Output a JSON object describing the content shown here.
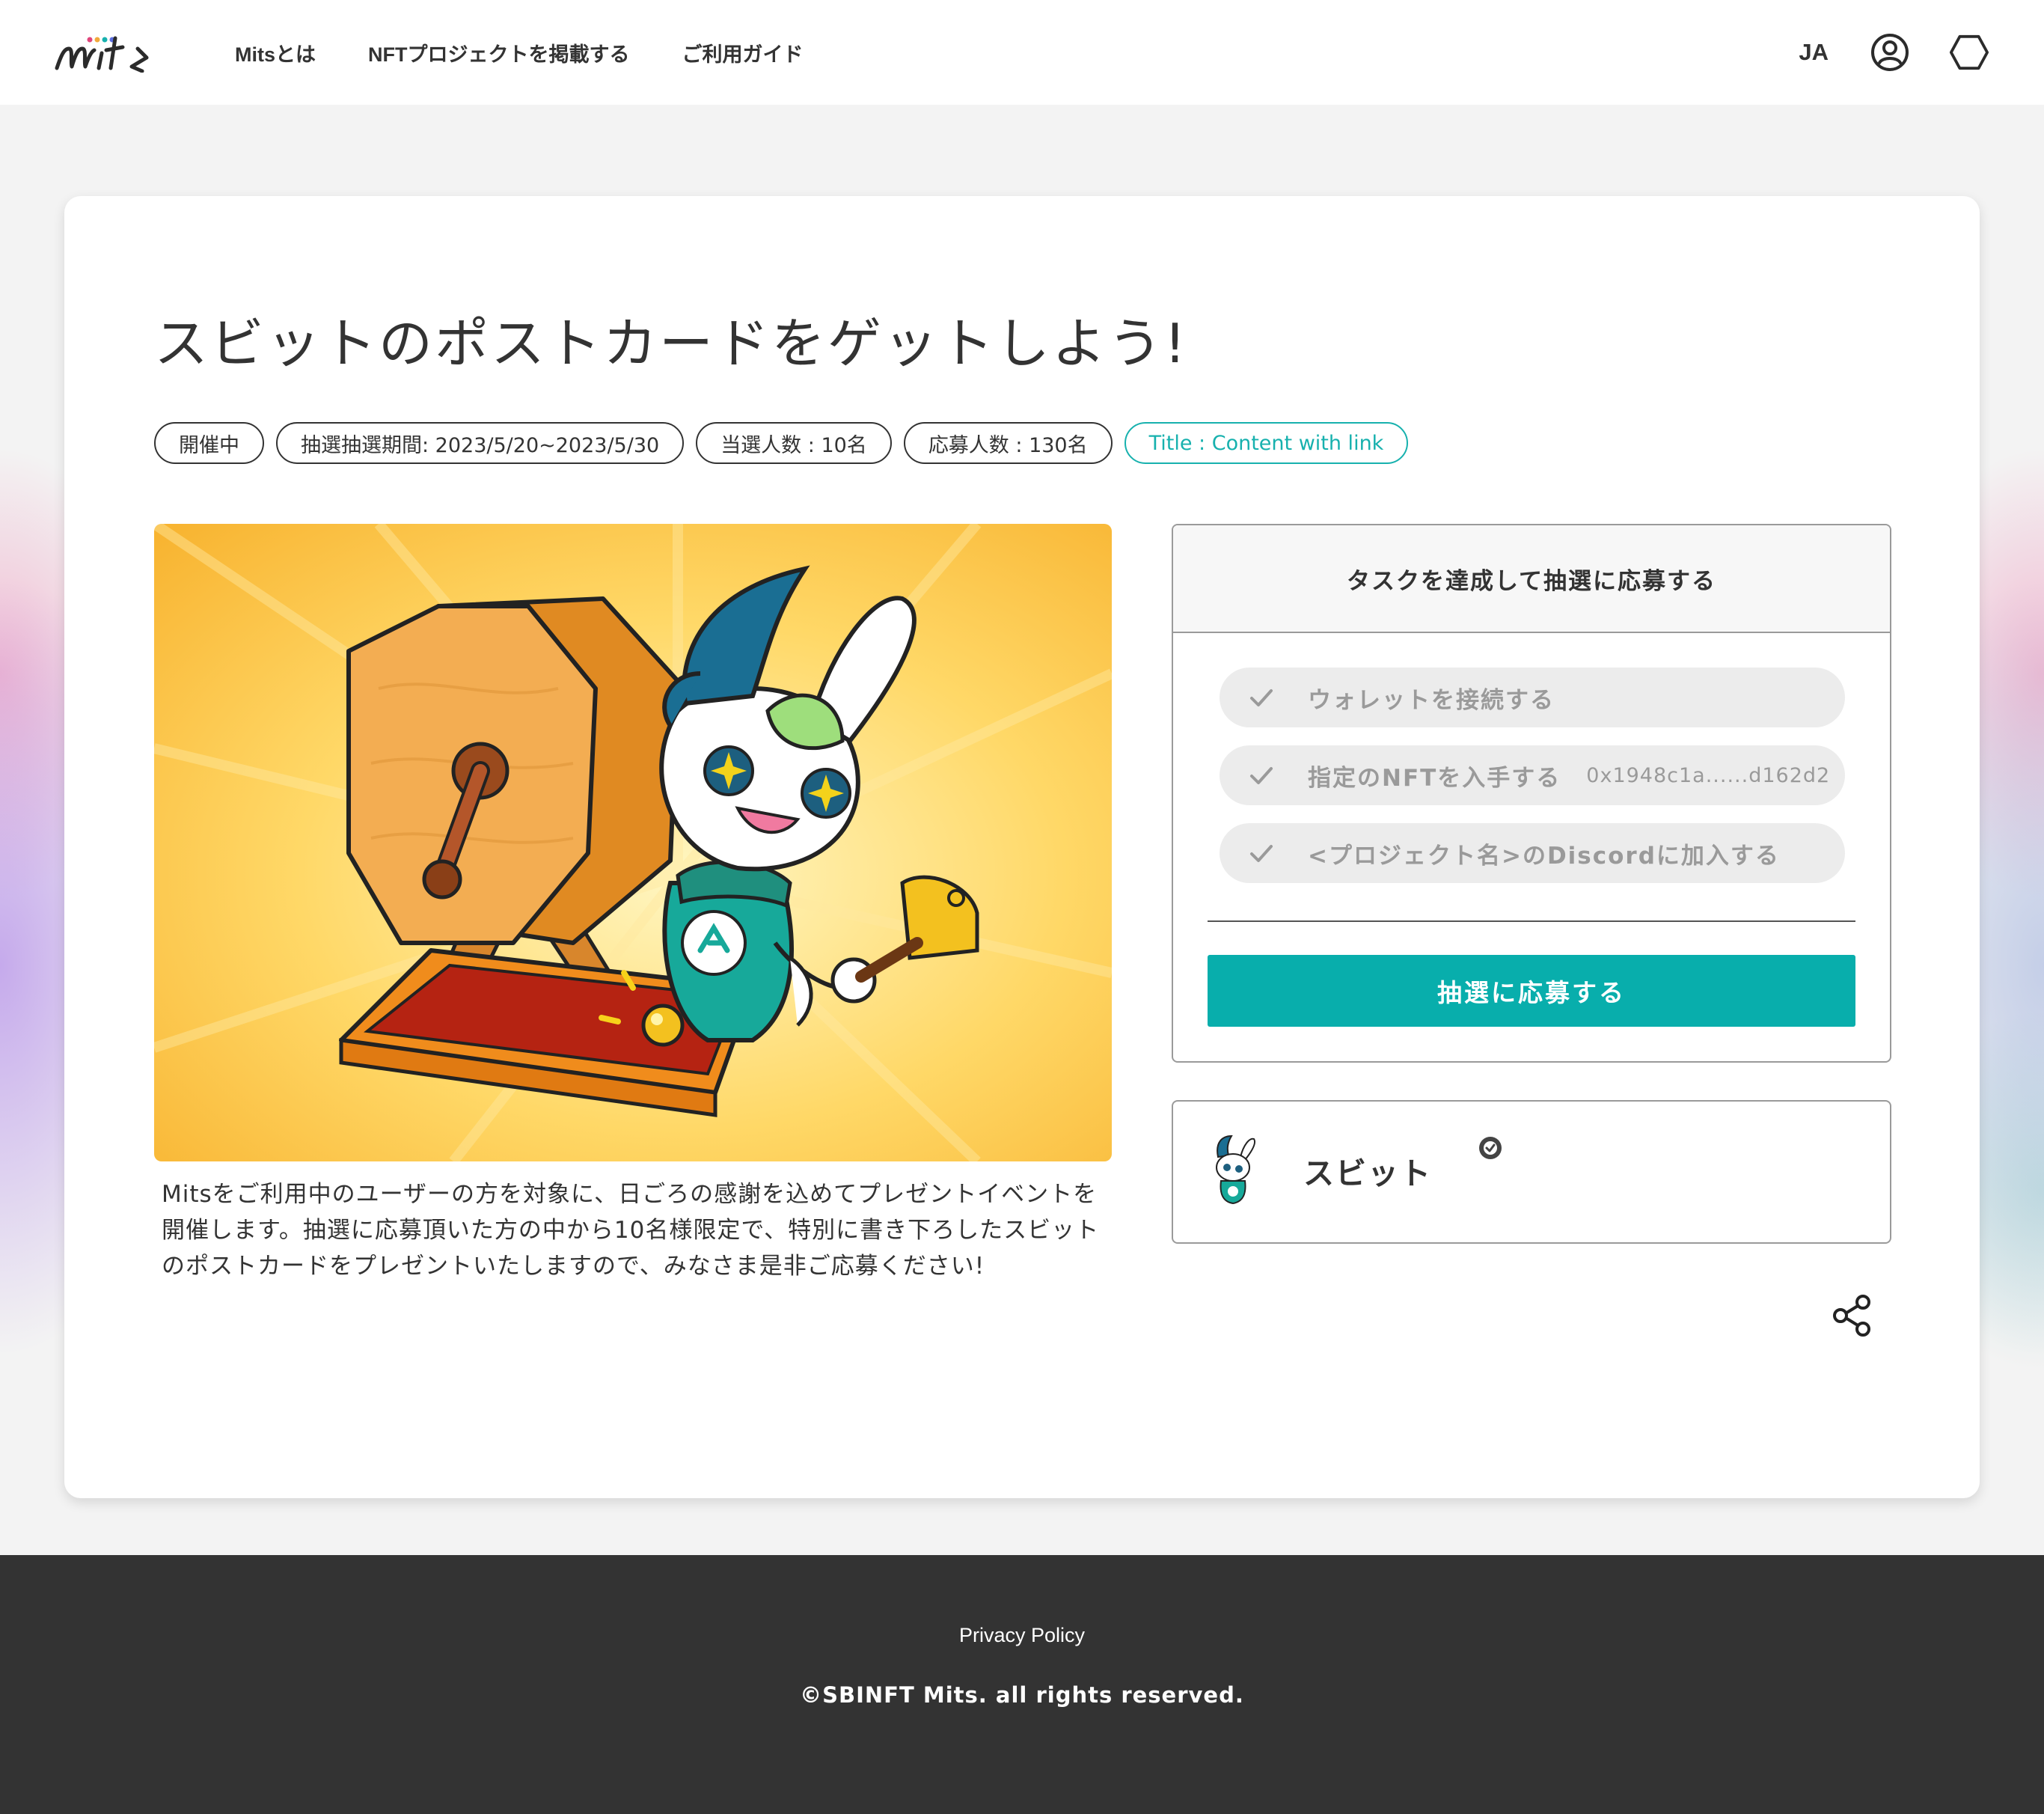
{
  "header": {
    "logo_text": "mits",
    "nav": [
      {
        "label": "Mitsとは"
      },
      {
        "label": "NFTプロジェクトを掲載する"
      },
      {
        "label": "ご利用ガイド"
      }
    ],
    "language": "JA",
    "icons": [
      "user-circle-icon",
      "wallet-hexagon-icon"
    ]
  },
  "campaign": {
    "title": "スビットのポストカードをゲットしよう!",
    "tags": {
      "status": "開催中",
      "period": "抽選抽選期間: 2023/5/20~2023/5/30",
      "winners": "当選人数 : 10名",
      "applicants": "応募人数 : 130名",
      "link": "Title : Content with link"
    },
    "description": "Mitsをご利用中のユーザーの方を対象に、日ごろの感謝を込めてプレゼントイベントを開催します。抽選に応募頂いた方の中から10名様限定で、特別に書き下ろしたスビットのポストカードをプレゼントいたしますので、みなさま是非ご応募ください!"
  },
  "task_panel": {
    "heading": "タスクを達成して抽選に応募する",
    "tasks": [
      {
        "label": "ウォレットを接続する",
        "detail": ""
      },
      {
        "label": "指定のNFTを入手する",
        "detail": "0x1948c1a......d162d2"
      },
      {
        "label": "<プロジェクト名>のDiscordに加入する",
        "detail": ""
      }
    ],
    "apply_label": "抽選に応募する"
  },
  "project": {
    "name": "スビット",
    "verified": true
  },
  "colors": {
    "accent": "#08aeac",
    "text": "#333333",
    "muted": "#9a9a9a",
    "footer_bg": "#333333"
  },
  "footer": {
    "privacy": "Privacy Policy",
    "copyright": "©SBINFT Mits. all rights reserved."
  }
}
